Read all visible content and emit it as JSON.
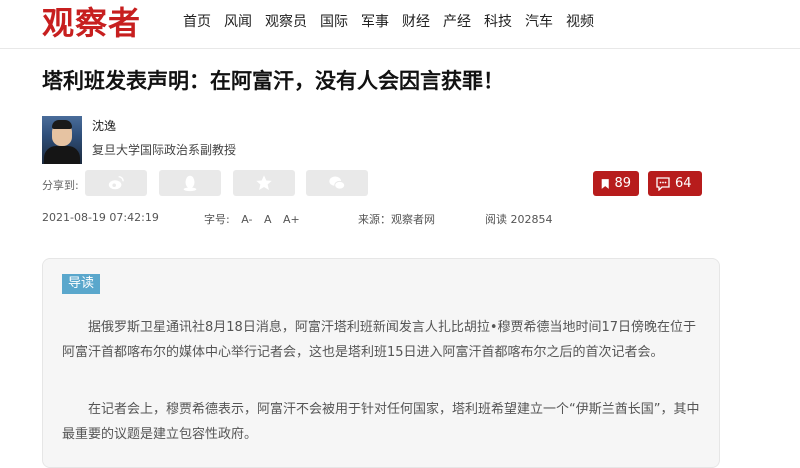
{
  "site": {
    "logo": "观察者"
  },
  "nav": [
    "首页",
    "风闻",
    "观察员",
    "国际",
    "军事",
    "财经",
    "产经",
    "科技",
    "汽车",
    "视频"
  ],
  "article": {
    "title": "塔利班发表声明：在阿富汗，没有人会因言获罪！",
    "author": {
      "name": "沈逸",
      "title": "复旦大学国际政治系副教授"
    },
    "share_label": "分享到:",
    "share_icons": [
      "weibo-icon",
      "qq-icon",
      "qzone-star-icon",
      "wechat-icon"
    ],
    "bookmark_count": "89",
    "comment_count": "64",
    "datetime": "2021-08-19 07:42:19",
    "font_size_label": "字号:",
    "font_sizes": [
      "A-",
      "A",
      "A+"
    ],
    "source": "来源：观察者网",
    "views": "阅读 202854",
    "digest": {
      "tag": "导读",
      "paragraphs": [
        "据俄罗斯卫星通讯社8月18日消息，阿富汗塔利班新闻发言人扎比胡拉•穆贾希德当地时间17日傍晚在位于阿富汗首都喀布尔的媒体中心举行记者会，这也是塔利班15日进入阿富汗首都喀布尔之后的首次记者会。",
        "在记者会上，穆贾希德表示，阿富汗不会被用于针对任何国家，塔利班希望建立一个“伊斯兰酋长国”，其中最重要的议题是建立包容性政府。"
      ]
    }
  },
  "colors": {
    "brand": "#c71f1f",
    "counter": "#b71c1c",
    "tag": "#5aa7cc"
  }
}
